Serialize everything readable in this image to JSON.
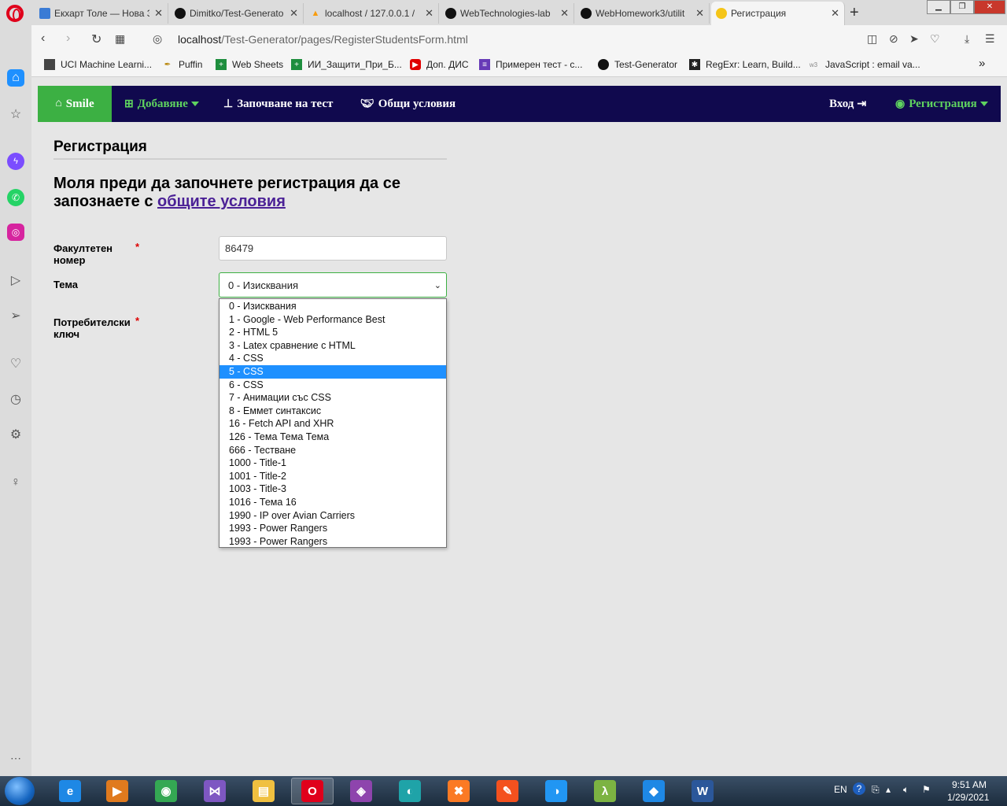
{
  "browser": {
    "tabs": [
      {
        "title": "Екхарт Толе — Нова З",
        "favicon": "image-icon",
        "color": "#3a7bd5"
      },
      {
        "title": "Dimitko/Test-Generato",
        "favicon": "github-icon",
        "color": "#111111"
      },
      {
        "title": "localhost / 127.0.0.1 / ",
        "favicon": "phpmyadmin-icon",
        "color": "#f89c0e"
      },
      {
        "title": "WebTechnologies-lab",
        "favicon": "github-icon",
        "color": "#111111"
      },
      {
        "title": "WebHomework3/utilit",
        "favicon": "github-icon",
        "color": "#111111"
      },
      {
        "title": "Регистрация",
        "favicon": "emoji-icon",
        "color": "#f5c518"
      }
    ],
    "url_host": "localhost",
    "url_path": "/Test-Generator/pages/RegisterStudentsForm.html",
    "bookmarks": [
      {
        "label": "UCI Machine Learni...",
        "icon": "document-icon",
        "color": "#444444"
      },
      {
        "label": "Puffin",
        "icon": "puffin-icon",
        "color": "#b8860b"
      },
      {
        "label": "Web Sheets",
        "icon": "sheets-icon",
        "color": "#1e8e3e"
      },
      {
        "label": "ИИ_Защити_При_Б...",
        "icon": "sheets-icon",
        "color": "#1e8e3e"
      },
      {
        "label": "Доп. ДИС",
        "icon": "youtube-icon",
        "color": "#e00000"
      },
      {
        "label": "Примерен тест - с...",
        "icon": "forms-icon",
        "color": "#673ab7"
      },
      {
        "label": "Test-Generator",
        "icon": "github-icon",
        "color": "#111111"
      },
      {
        "label": "RegExr: Learn, Build...",
        "icon": "regexr-icon",
        "color": "#222222"
      },
      {
        "label": "JavaScript : email va...",
        "icon": "w3schools-icon",
        "color": "#888888"
      }
    ],
    "bookmarks_more": "»"
  },
  "navbar": {
    "brand": "Smile",
    "add": "Добавяне",
    "start_test": "Започване на тест",
    "terms": "Общи условия",
    "login": "Вход",
    "register": "Регистрация"
  },
  "form": {
    "title": "Регистрация",
    "intro_text": "Моля преди да започнете регистрация да се запознаете с ",
    "intro_link": "общите условия",
    "faculty_label": "Факултетен номер",
    "faculty_value": "86479",
    "theme_label": "Тема",
    "theme_selected": "0 - Изисквания",
    "key_label": "Потребителски ключ",
    "required_mark": "*",
    "theme_options": [
      "0 - Изисквания",
      "1 - Google - Web Performance Best",
      "2 - HTML 5",
      "3 - Latex сравнение с HTML",
      "4 - CSS",
      "5 - CSS",
      "6 - CSS",
      "7 - Анимации със CSS",
      "8 - Еммет синтаксис",
      "16 - Fetch API and XHR",
      "126 - Тема Тема Тема",
      "666 - Тестване",
      "1000 - Title-1",
      "1001 - Title-2",
      "1003 - Title-3",
      "1016 - Тема 16",
      "1990 - IP over Avian Carriers",
      "1993 - Power Rangers",
      "1993 - Power Rangers"
    ],
    "highlighted_option_index": 5
  },
  "taskbar": {
    "language": "EN",
    "time": "9:51 AM",
    "date": "1/29/2021",
    "apps": [
      {
        "name": "internet-explorer-icon",
        "glyph": "e",
        "color": "#1e88e5"
      },
      {
        "name": "media-player-icon",
        "glyph": "▶",
        "color": "#e07a1e"
      },
      {
        "name": "chrome-icon",
        "glyph": "◉",
        "color": "#34a853"
      },
      {
        "name": "visual-studio-purple-icon",
        "glyph": "⋈",
        "color": "#7e57c2"
      },
      {
        "name": "file-explorer-icon",
        "glyph": "▤",
        "color": "#f0c040"
      },
      {
        "name": "opera-icon",
        "glyph": "O",
        "color": "#e0001b"
      },
      {
        "name": "visual-studio-icon",
        "glyph": "◈",
        "color": "#8e44ad"
      },
      {
        "name": "edge-icon",
        "glyph": "◐",
        "color": "#1fa3a8"
      },
      {
        "name": "xampp-icon",
        "glyph": "✖",
        "color": "#fb7a24"
      },
      {
        "name": "pen-tool-icon",
        "glyph": "✎",
        "color": "#f4511e"
      },
      {
        "name": "paint-icon",
        "glyph": "◑",
        "color": "#2196f3"
      },
      {
        "name": "lambda-icon",
        "glyph": "λ",
        "color": "#7cb342"
      },
      {
        "name": "vscode-icon",
        "glyph": "◆",
        "color": "#1e88e5"
      },
      {
        "name": "word-icon",
        "glyph": "W",
        "color": "#2b579a"
      }
    ]
  }
}
